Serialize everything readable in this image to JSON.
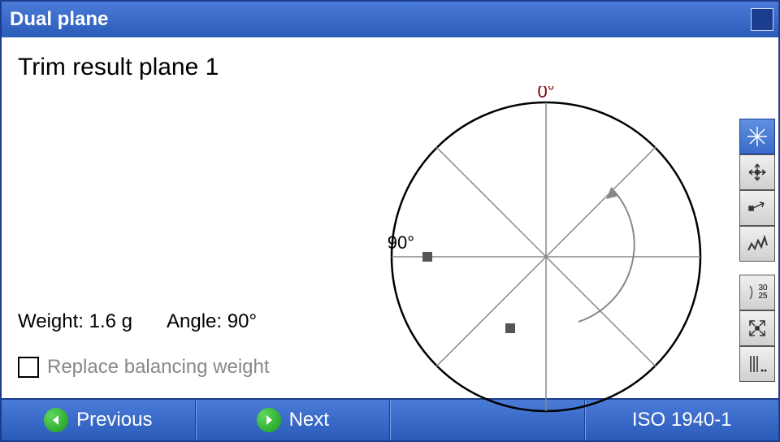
{
  "window": {
    "title": "Dual plane"
  },
  "page": {
    "heading": "Trim result plane 1",
    "weight_label": "Weight:",
    "weight_value": "1.6 g",
    "angle_label": "Angle:",
    "angle_value": "90°",
    "replace_label": "Replace balancing weight",
    "replace_checked": false
  },
  "polar": {
    "label_0": "0°",
    "label_90": "90°"
  },
  "toolbar": {
    "items": [
      {
        "name": "polar-view-icon",
        "selected": true
      },
      {
        "name": "move-icon",
        "selected": false
      },
      {
        "name": "vector-icon",
        "selected": false
      },
      {
        "name": "spline-icon",
        "selected": false
      }
    ],
    "group2": [
      {
        "name": "angle-3025-icon",
        "label": "30\n25"
      },
      {
        "name": "collapse-icon"
      },
      {
        "name": "options-icon"
      }
    ]
  },
  "bottom": {
    "previous": "Previous",
    "next": "Next",
    "standard": "ISO 1940-1"
  }
}
